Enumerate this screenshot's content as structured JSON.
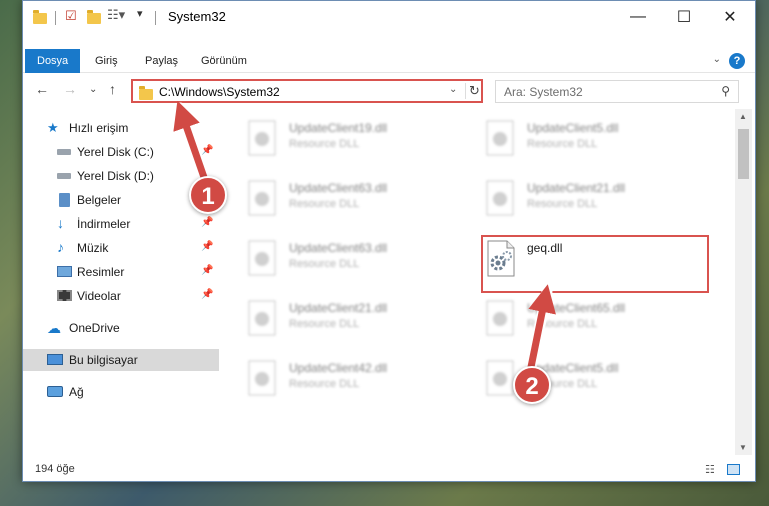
{
  "window": {
    "title": "System32"
  },
  "ribbon": {
    "tabs": [
      {
        "label": "Dosya"
      },
      {
        "label": "Giriş"
      },
      {
        "label": "Paylaş"
      },
      {
        "label": "Görünüm"
      }
    ]
  },
  "navbar": {
    "address": "C:\\Windows\\System32",
    "search_placeholder": "Ara: System32"
  },
  "sidebar": {
    "items": [
      {
        "label": "Hızlı erişim",
        "icon": "star-icon"
      },
      {
        "label": "Yerel Disk (C:)",
        "icon": "drive-icon",
        "pinned": true
      },
      {
        "label": "Yerel Disk (D:)",
        "icon": "drive-icon"
      },
      {
        "label": "Belgeler",
        "icon": "documents-icon",
        "pinned": true
      },
      {
        "label": "İndirmeler",
        "icon": "download-icon",
        "pinned": true
      },
      {
        "label": "Müzik",
        "icon": "music-icon",
        "pinned": true
      },
      {
        "label": "Resimler",
        "icon": "pictures-icon",
        "pinned": true
      },
      {
        "label": "Videolar",
        "icon": "videos-icon",
        "pinned": true
      },
      {
        "label": "OneDrive",
        "icon": "cloud-icon"
      },
      {
        "label": "Bu bilgisayar",
        "icon": "computer-icon",
        "selected": true
      },
      {
        "label": "Ağ",
        "icon": "network-icon"
      }
    ]
  },
  "files": [
    {
      "name": "UpdateClient19.dll",
      "type": "Resource DLL"
    },
    {
      "name": "UpdateClient5.dll",
      "type": "Resource DLL"
    },
    {
      "name": "UpdateClient63.dll",
      "type": "Resource DLL"
    },
    {
      "name": "UpdateClient21.dll",
      "type": "Resource DLL"
    },
    {
      "name": "UpdateClient63.dll",
      "type": "Resource DLL"
    },
    {
      "name": "geq.dll",
      "type": ""
    },
    {
      "name": "UpdateClient21.dll",
      "type": "Resource DLL"
    },
    {
      "name": "UpdateClient65.dll",
      "type": "Resource DLL"
    },
    {
      "name": "UpdateClient42.dll",
      "type": "Resource DLL"
    },
    {
      "name": "UpdateClient5.dll",
      "type": "Resource DLL"
    }
  ],
  "status": {
    "item_count": "194 öğe"
  },
  "annotations": {
    "marker1": "1",
    "marker2": "2"
  },
  "colors": {
    "accent": "#1979ca",
    "annotation": "#d9534f"
  }
}
